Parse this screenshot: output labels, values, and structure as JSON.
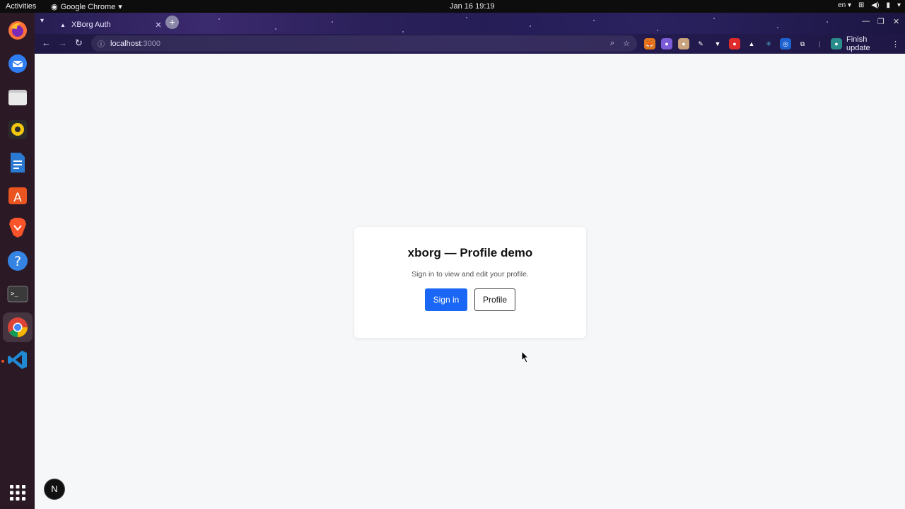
{
  "topbar": {
    "activities": "Activities",
    "app_name": "Google Chrome",
    "clock": "Jan 16  19:19",
    "lang": "en"
  },
  "dock": {
    "items": [
      {
        "name": "firefox-icon",
        "color": "#ff7139"
      },
      {
        "name": "thunderbird-icon",
        "color": "#2f7df3"
      },
      {
        "name": "files-icon",
        "color": "#b9b9b9"
      },
      {
        "name": "rhythmbox-icon",
        "color": "#f2c811"
      },
      {
        "name": "libreoffice-writer-icon",
        "color": "#2a7ad4"
      },
      {
        "name": "app-center-icon",
        "color": "#e95420"
      },
      {
        "name": "brave-icon",
        "color": "#fb542b"
      },
      {
        "name": "help-icon",
        "color": "#3584e4"
      },
      {
        "name": "terminal-icon",
        "color": "#333333"
      },
      {
        "name": "chrome-icon",
        "color": "#4285f4"
      },
      {
        "name": "vscode-icon",
        "color": "#1f8ad2"
      },
      {
        "name": "show-apps-icon",
        "color": "#ffffff"
      }
    ]
  },
  "browser": {
    "tab_title": "XBorg Auth",
    "url_host": "localhost",
    "url_port": ":3000",
    "finish_update": "Finish update"
  },
  "page": {
    "title": "xborg — Profile demo",
    "subtitle": "Sign in to view and edit your profile.",
    "signin_label": "Sign in",
    "profile_label": "Profile",
    "next_badge": "N"
  },
  "colors": {
    "primary": "#1a66f5",
    "page_bg": "#f6f7f9"
  }
}
